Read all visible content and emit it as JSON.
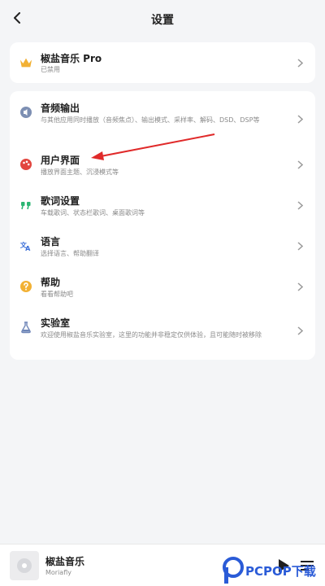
{
  "header": {
    "title": "设置",
    "back_icon": "chevron-left-icon"
  },
  "pro": {
    "title": "椒盐音乐 Pro",
    "subtitle": "已禁用",
    "icon": "crown-icon",
    "icon_color": "#f2b134"
  },
  "settings": [
    {
      "id": "audio-output",
      "title": "音频输出",
      "subtitle": "与其他应用同时播放（音频焦点）、输出模式、采样率、解码、DSD、DSP等",
      "icon": "speaker-icon",
      "color": "#7d8fb3"
    },
    {
      "id": "user-interface",
      "title": "用户界面",
      "subtitle": "播放界面主题、沉浸模式等",
      "icon": "palette-icon",
      "color": "#e2463f"
    },
    {
      "id": "lyrics",
      "title": "歌词设置",
      "subtitle": "车载歌词、状态栏歌词、桌面歌词等",
      "icon": "quote-icon",
      "color": "#2bb673"
    },
    {
      "id": "language",
      "title": "语言",
      "subtitle": "选择语言、帮助翻译",
      "icon": "translate-icon",
      "color": "#3b6fd8"
    },
    {
      "id": "help",
      "title": "帮助",
      "subtitle": "看看帮助吧",
      "icon": "help-icon",
      "color": "#f2b134"
    },
    {
      "id": "lab",
      "title": "实验室",
      "subtitle": "欢迎使用椒盐音乐实验室，这里的功能并非稳定仅供体验，且可能随时被移除",
      "icon": "flask-icon",
      "color": "#6f86b8"
    }
  ],
  "annotation": {
    "arrow_color": "#e02a2a"
  },
  "player": {
    "title": "椒盐音乐",
    "artist": "Moriafly",
    "play_icon": "play-icon",
    "queue_icon": "queue-icon"
  },
  "watermark": {
    "text": "PCPOP下载"
  }
}
